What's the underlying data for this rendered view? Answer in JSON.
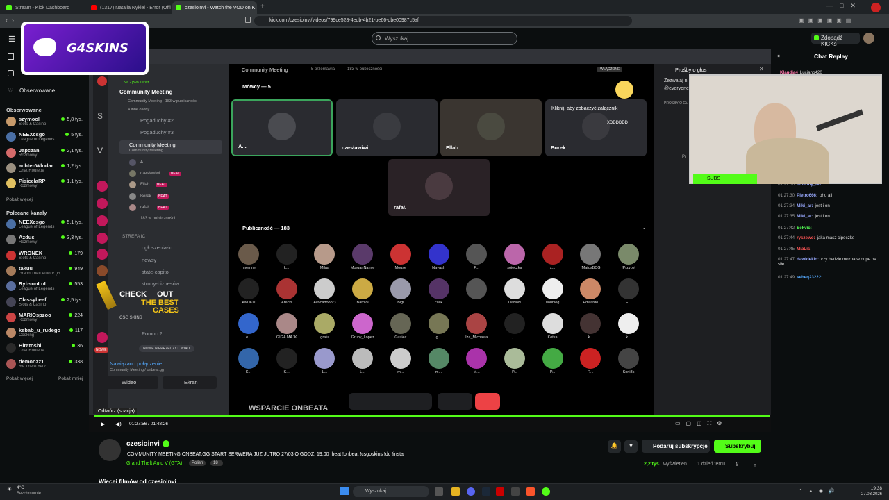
{
  "tabs": [
    {
      "label": "Stream - Kick Dashboard",
      "color": "#53fc18"
    },
    {
      "label": "(1317) Natalia Nykiel - Error (Offi",
      "color": "#ff0000"
    },
    {
      "label": "czesioinvi - Watch the VOD on K",
      "color": "#53fc18"
    }
  ],
  "url": "kick.com/czesioinvi/videos/799ce528-4edb-4b21-be66-dbe00987c5af",
  "search_placeholder": "Wyszukaj",
  "kicks_button": "Zdobądź KICKs",
  "chat_title": "Chat Replay",
  "sidebar": {
    "home_label": "Obserwowane",
    "following_header": "Obserwowane",
    "following": [
      {
        "name": "szymool",
        "cat": "Slots & Casino",
        "viewers": "5,8 tys.",
        "color": "#c79a6b"
      },
      {
        "name": "NEEXcsgo",
        "cat": "League of Legends",
        "viewers": "5 tys.",
        "color": "#4a6fa5"
      },
      {
        "name": "Japczan",
        "cat": "Rozmowy",
        "viewers": "2,1 tys.",
        "color": "#d46a6a"
      },
      {
        "name": "achtenWlodar",
        "cat": "Chat Roulette",
        "viewers": "1,2 tys.",
        "color": "#9a8f7f"
      },
      {
        "name": "PisicelaRP",
        "cat": "Rozmowy",
        "viewers": "1,1 tys.",
        "color": "#e0c060"
      }
    ],
    "show_more_1": "Pokaż więcej",
    "recommended_header": "Polecane kanały",
    "recommended": [
      {
        "name": "NEEXcsgo",
        "cat": "League of Legends",
        "viewers": "5,1 tys.",
        "color": "#4a6fa5"
      },
      {
        "name": "Azdus",
        "cat": "Rozmowy",
        "viewers": "3,3 tys.",
        "color": "#777"
      },
      {
        "name": "WRONEK",
        "cat": "Slots & Casino",
        "viewers": "179",
        "color": "#c33"
      },
      {
        "name": "takuu",
        "cat": "Grand Theft Auto V (G...",
        "viewers": "949",
        "color": "#a57b5a"
      },
      {
        "name": "RybsonLoL",
        "cat": "League of Legends",
        "viewers": "553",
        "color": "#5a6e9e"
      },
      {
        "name": "Classybeef",
        "cat": "Slots & Casino",
        "viewers": "2,5 tys.",
        "color": "#445"
      },
      {
        "name": "MARIOspzoo",
        "cat": "Rozmowy",
        "viewers": "224",
        "color": "#c44"
      },
      {
        "name": "kebab_u_rudego",
        "cat": "Cooking",
        "viewers": "117",
        "color": "#b86"
      },
      {
        "name": "Hiratoshi",
        "cat": "Chat Roulette",
        "viewers": "36",
        "color": "#2a2a2a"
      },
      {
        "name": "demonzz1",
        "cat": "RV There Yet?",
        "viewers": "338",
        "color": "#a55"
      }
    ],
    "show_more_2": "Pokaż więcej",
    "show_less": "Pokaż mniej"
  },
  "logo_text": "G4SKINS",
  "discord": {
    "now_live": "Na Żywo Teraz",
    "server_item": "Community Meeting",
    "sub_line": "Community Meeting · 183 w publiczności",
    "sub_line2": "4 inne osoby",
    "channels": [
      "Pogaduchy #2",
      "Pogaduchy #3"
    ],
    "active_channel": "Community Meeting",
    "active_sub": "Community Meeting",
    "users": [
      "A...",
      "czesławiwi",
      "Ellab",
      "Borek",
      "rafał."
    ],
    "beat": "BEAT",
    "audience_count": "183 w publiczności",
    "category": "STREFA IC",
    "text_channels": [
      "ogłoszenia-ic",
      "newsy",
      "state-capitol",
      "strony-biznesów"
    ],
    "ad_check": "CHECK",
    "ad_out": "OUT",
    "ad_best": "THE BEST",
    "ad_cases": "CASES",
    "ad_brand": "CSG SKINS",
    "pomoc": "Pomoc 2",
    "nowe": "NOWE",
    "nowe_msg": "NOWE NIEPRZECZYT. WIAD.",
    "conn_status": "Nawiązano połączenie",
    "conn_sub": "Community Meeting / onbeat.gg",
    "video_btn": "Wideo",
    "screen_btn": "Ekran",
    "stage_title": "Community Meeting",
    "stage_meta1": "5 przemawia",
    "stage_meta2": "183 w publiczności",
    "enabled_badge": "WŁĄCZONE",
    "speakers_header": "Mówcy — 5",
    "speakers": [
      {
        "name": "A...",
        "color": "#4a4b50"
      },
      {
        "name": "czesławiwi",
        "color": "#3a3b40"
      },
      {
        "name": "Ellab",
        "color": "#4a4a40"
      },
      {
        "name": "Borek",
        "color": "#3a3a3f"
      },
      {
        "name": "rafał.",
        "color": "#4a3a40"
      }
    ],
    "click_hint": "Kliknij, aby zobaczyć załącznik",
    "xddd": "XDDDDDD",
    "audience_header": "Publiczność — 183",
    "audience": [
      {
        "n": "!_memne_",
        "c": "#6a5a4a"
      },
      {
        "n": "k...",
        "c": "#222"
      },
      {
        "n": "Milaa",
        "c": "#b79a8a"
      },
      {
        "n": "MorganNanye",
        "c": "#5a3a6a"
      },
      {
        "n": "Mouse",
        "c": "#c33"
      },
      {
        "n": "Nayash",
        "c": "#33c"
      },
      {
        "n": "P...",
        "c": "#555"
      },
      {
        "n": "sójeczka",
        "c": "#b6a"
      },
      {
        "n": "x...",
        "c": "#a22"
      },
      {
        "n": "!MatosBDG",
        "c": "#777"
      },
      {
        "n": "!Przybył",
        "c": "#7a8a6a"
      },
      {
        "n": "AKUKU",
        "c": "#222"
      },
      {
        "n": "Arecki",
        "c": "#a33"
      },
      {
        "n": "Avocadooo :)",
        "c": "#ccc"
      },
      {
        "n": "Barniol",
        "c": "#ca4"
      },
      {
        "n": "Bigi",
        "c": "#99a"
      },
      {
        "n": "citek",
        "c": "#536"
      },
      {
        "n": "C...",
        "c": "#555"
      },
      {
        "n": "DaNoN",
        "c": "#ddd"
      },
      {
        "n": "doubleg",
        "c": "#eee"
      },
      {
        "n": "Edwardo",
        "c": "#c86"
      },
      {
        "n": "E...",
        "c": "#333"
      },
      {
        "n": "e...",
        "c": "#36c"
      },
      {
        "n": "GIGA MAJK",
        "c": "#a88"
      },
      {
        "n": "gralu",
        "c": "#aa6"
      },
      {
        "n": "Gruby_Lopez",
        "c": "#c6c"
      },
      {
        "n": "Guziec",
        "c": "#665"
      },
      {
        "n": "g...",
        "c": "#775"
      },
      {
        "n": "Iza_Michasia",
        "c": "#a44"
      },
      {
        "n": "j...",
        "c": "#222"
      },
      {
        "n": "Kotka",
        "c": "#ddd"
      },
      {
        "n": "k...",
        "c": "#433"
      },
      {
        "n": "k...",
        "c": "#eee"
      },
      {
        "n": "K...",
        "c": "#36a"
      },
      {
        "n": "K...",
        "c": "#222"
      },
      {
        "n": "L...",
        "c": "#99c"
      },
      {
        "n": "L...",
        "c": "#bbb"
      },
      {
        "n": "m...",
        "c": "#ccc"
      },
      {
        "n": "m...",
        "c": "#586"
      },
      {
        "n": "M...",
        "c": "#a3a"
      },
      {
        "n": "P...",
        "c": "#ab9"
      },
      {
        "n": "P...",
        "c": "#4a4"
      },
      {
        "n": "R...",
        "c": "#c22"
      },
      {
        "n": "Soni3k",
        "c": "#444"
      }
    ],
    "footer_text": "WSPARCIE ONBEATA",
    "dr_title": "Prośby o głos",
    "dr_line1": "Zezwalaj n",
    "dr_line2": "@everyone",
    "dr_prosby": "PROŚBY O GŁ",
    "dr_p": "Pr"
  },
  "player": {
    "tooltip": "Odtwórz (spacja)",
    "time": "01:27:56 / 01:48:26"
  },
  "webcam_label": "SUBS",
  "chat": [
    {
      "t": "",
      "u": "Klaudia4",
      "uc": "#f7a",
      "m": "Luciano420"
    },
    {
      "t": "01:27:30",
      "u": "mroziny_oo:",
      "uc": "#9af",
      "m": ""
    },
    {
      "t": "01:27:30",
      "u": "Pietro666:",
      "uc": "#9af",
      "m": "oho ali"
    },
    {
      "t": "01:27:34",
      "u": "Miki_ar:",
      "uc": "#9af",
      "m": "jest i on"
    },
    {
      "t": "01:27:35",
      "u": "Miki_ar:",
      "uc": "#9af",
      "m": "jest i on"
    },
    {
      "t": "01:27:42",
      "u": "Sekvic:",
      "uc": "#5f5",
      "m": ""
    },
    {
      "t": "01:27:44",
      "u": "ryszewo:",
      "uc": "#f55",
      "m": "jaka masz cipeczke"
    },
    {
      "t": "01:27:45",
      "u": "MiaLis:",
      "uc": "#f55",
      "m": ""
    },
    {
      "t": "01:27:47",
      "u": "dawidekio:",
      "uc": "#9af",
      "m": "czy bedzie mozna w dupe na siłe"
    },
    {
      "t": "01:27:49",
      "u": "sebeq23222:",
      "uc": "#5af",
      "m": ""
    }
  ],
  "channel": {
    "name": "czesioinvi",
    "title": "COMMUNITY MEETING ONBEAT.GG START SERWERA JUZ JUTRO 27/03 O GODZ. 19:00 !heat !onbeat !csgoskins !dc !insta",
    "category": "Grand Theft Auto V (GTA)",
    "tag1": "Polish",
    "tag2": "18+",
    "gift_btn": "Podaruj subskrypcje",
    "sub_btn": "Subskrybuj",
    "views": "2,2 tys.",
    "views_label": "wyświetleń",
    "age": "1 dzień temu",
    "more_videos": "Więcej filmów od czesioinvi"
  },
  "taskbar": {
    "weather_temp": "4°C",
    "weather_desc": "Bezchmurnie",
    "search": "Wyszukaj",
    "time": "19:38",
    "date": "27.03.2026"
  }
}
